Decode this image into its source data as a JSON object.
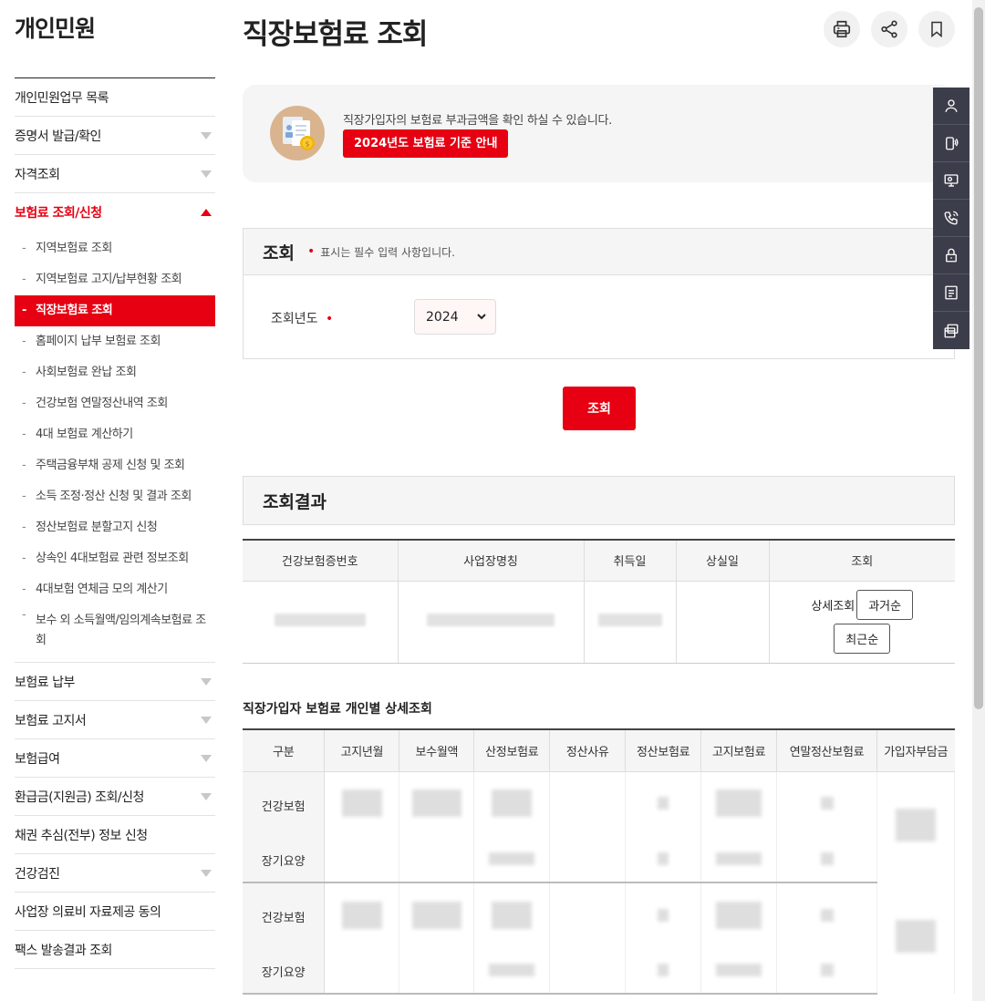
{
  "sidebar": {
    "title": "개인민원",
    "items": [
      {
        "label": "개인민원업무 목록"
      },
      {
        "label": "증명서 발급/확인"
      },
      {
        "label": "자격조회"
      },
      {
        "label": "보험료 조회/신청"
      },
      {
        "label": "보험료 납부"
      },
      {
        "label": "보험료 고지서"
      },
      {
        "label": "보험급여"
      },
      {
        "label": "환급금(지원금) 조회/신청"
      },
      {
        "label": "채권 추심(전부) 정보 신청"
      },
      {
        "label": "건강검진"
      },
      {
        "label": "사업장 의료비 자료제공 동의"
      },
      {
        "label": "팩스 발송결과 조회"
      }
    ],
    "submenu": [
      "지역보험료 조회",
      "지역보험료 고지/납부현황 조회",
      "직장보험료 조회",
      "홈페이지 납부 보험료 조회",
      "사회보험료 완납 조회",
      "건강보험 연말정산내역 조회",
      "4대 보험료 계산하기",
      "주택금융부채 공제 신청 및 조회",
      "소득 조정·정산 신청 및 결과 조회",
      "정산보험료 분할고지 신청",
      "상속인 4대보험료 관련 정보조회",
      "4대보험 연체금 모의 계산기",
      "보수 외 소득월액/임의계속보험료 조회"
    ]
  },
  "page": {
    "title": "직장보험료 조회"
  },
  "notice": {
    "text": "직장가입자의 보험료 부과금액을 확인 하실 수 있습니다.",
    "button": "2024년도 보험료 기준 안내"
  },
  "search": {
    "title": "조회",
    "required_note": "표시는 필수 입력 사항입니다.",
    "required_mark": "•",
    "year_label": "조회년도",
    "year_value": "2024",
    "submit": "조회"
  },
  "result": {
    "title": "조회결과",
    "columns": [
      "건강보험증번호",
      "사업장명칭",
      "취득일",
      "상실일",
      "조회"
    ],
    "detail_label": "상세조회",
    "btn_past": "과거순",
    "btn_recent": "최근순"
  },
  "detail": {
    "title": "직장가입자 보험료 개인별 상세조회",
    "columns": [
      "구분",
      "고지년월",
      "보수월액",
      "산정보험료",
      "정산사유",
      "정산보험료",
      "고지보험료",
      "연말정산보험료",
      "가입자부담금"
    ],
    "row_health": "건강보험",
    "row_care": "장기요양"
  },
  "colors": {
    "accent": "#e60012",
    "quickbar": "#3c3d4a"
  }
}
